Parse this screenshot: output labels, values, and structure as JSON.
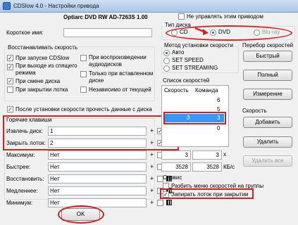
{
  "window": {
    "title": "CDSlow 4.0 - Настройки привода"
  },
  "drive": {
    "name": "Optiarc  DVD RW AD-7263S  1.00"
  },
  "left": {
    "short_name_label": "Короткое имя:",
    "short_name_value": "",
    "restore_section": "Восстанавливать скорость",
    "restore_options": [
      "При запуске CDSlow",
      "При выходе из спящего режима",
      "При смене диска",
      "При закрытии лотка",
      "При воспроизведении аудиодисков",
      "Только при вставленном диске",
      "Независимо от текущей"
    ],
    "after_speed_label": "После установки скорости прочесть данные с диска",
    "hotkeys_title": "Горячие клавиши",
    "hotkeys": [
      {
        "label": "Извлечь диск:",
        "value": "1",
        "plus": "+"
      },
      {
        "label": "Закрыть лоток:",
        "value": "2",
        "plus": "+"
      },
      {
        "label": "Максимум:",
        "value": "Нет",
        "plus": "+"
      },
      {
        "label": "Быстрее:",
        "value": "Нет",
        "plus": "+"
      },
      {
        "label": "Восстановить:",
        "value": "Нет",
        "plus": "+"
      },
      {
        "label": "Медленнее:",
        "value": "Нет",
        "plus": "+"
      },
      {
        "label": "Минимум:",
        "value": "Нет",
        "plus": "+"
      }
    ],
    "ok_label": "OK"
  },
  "right": {
    "no_manage_label": "Не управлять этим приводом",
    "disc_type_title": "Тип диска",
    "disc_types": [
      "CD",
      "DVD",
      "Blu-ray"
    ],
    "speed_method_title": "Метод установки скорости",
    "speed_methods": [
      "Авто",
      "SET SPEED",
      "SET STREAMING"
    ],
    "speeds_title": "Список скоростей",
    "speeds_headers": [
      "Скорость",
      "Команда"
    ],
    "speeds_rows": [
      {
        "speed": "",
        "command": "6"
      },
      {
        "speed": "",
        "command": "5"
      },
      {
        "speed": "3",
        "command": "3"
      },
      {
        "speed": "",
        "command": "0"
      }
    ],
    "speed_inputs": {
      "speed": "3",
      "command": "3",
      "x_label": "x"
    },
    "kbs": {
      "value1": "3528",
      "value2": "3528",
      "unit": "КБ/с"
    },
    "profile_title": "Перебор скоростей",
    "profile_buttons": [
      "Быстрый",
      "Полный",
      "Измерение"
    ],
    "speed_title": "Скорость",
    "speed_buttons": [
      "Добавить",
      "Удалить",
      "Удалить все"
    ],
    "service_title": "Сервис",
    "service_options": [
      "Разбить меню скоростей на группы",
      "Запирать лоток при закрытии"
    ]
  },
  "colors": {
    "accent": "#d42020",
    "selection": "#3399ff"
  }
}
